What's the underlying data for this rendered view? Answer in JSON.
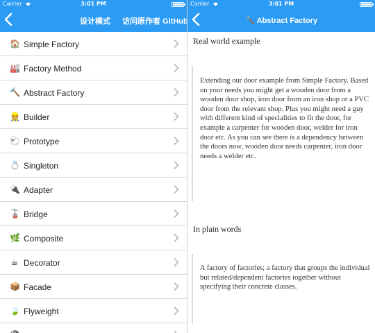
{
  "status_bar": {
    "carrier": "Carrier",
    "wifi_icon": "wifi-icon",
    "time": "3:01 PM",
    "battery_icon": "battery-icon"
  },
  "left_screen": {
    "nav": {
      "back_icon": "chevron-left-icon",
      "patterns_link": "设计模式",
      "github_link": "访问原作者 GitHub"
    },
    "items": [
      {
        "label": "Simple Factory",
        "icon": "house-icon",
        "glyph": "🏠"
      },
      {
        "label": "Factory Method",
        "icon": "factory-icon",
        "glyph": "🏭"
      },
      {
        "label": "Abstract Factory",
        "icon": "hammer-icon",
        "glyph": "🔨"
      },
      {
        "label": "Builder",
        "icon": "construction-worker-icon",
        "glyph": "👷"
      },
      {
        "label": "Prototype",
        "icon": "sheep-icon",
        "glyph": "🐑"
      },
      {
        "label": "Singleton",
        "icon": "ring-icon",
        "glyph": "💍"
      },
      {
        "label": "Adapter",
        "icon": "plug-icon",
        "glyph": "🔌"
      },
      {
        "label": "Bridge",
        "icon": "tram-icon",
        "glyph": "🚡"
      },
      {
        "label": "Composite",
        "icon": "herb-icon",
        "glyph": "🌿"
      },
      {
        "label": "Decorator",
        "icon": "coffee-icon",
        "glyph": "☕"
      },
      {
        "label": "Facade",
        "icon": "package-icon",
        "glyph": "📦"
      },
      {
        "label": "Flyweight",
        "icon": "leaf-icon",
        "glyph": "🍃"
      },
      {
        "label": "",
        "icon": "partial-icon",
        "glyph": "🎱"
      }
    ],
    "chevron_icon": "chevron-right-icon"
  },
  "right_screen": {
    "nav": {
      "back_icon": "chevron-left-icon",
      "title_icon": "hammer-icon",
      "title_glyph": "🔨",
      "title": "Abstract Factory"
    },
    "sections": [
      {
        "heading": "Real world example",
        "text": "Extending our door example from Simple Factory. Based on your needs you might get a wooden door from a wooden door shop, iron door from an iron shop or a PVC door from the relevant shop. Plus you might need a guy with different kind of specialities to fit the door, for example a carpenter for wooden door, welder for iron door etc. As you can see there is a dependency between the doors now, wooden door needs carpenter, iron door needs a welder etc."
      },
      {
        "heading": "In plain words",
        "text": "A factory of factories; a factory that groups the individual but related/dependent factories together without specifying their concrete classes."
      }
    ]
  },
  "colors": {
    "nav_blue": "#2b9bf4",
    "separator": "#d6d6d6",
    "quote_border": "#d9d9d9",
    "chevron": "#b4b4b9"
  }
}
